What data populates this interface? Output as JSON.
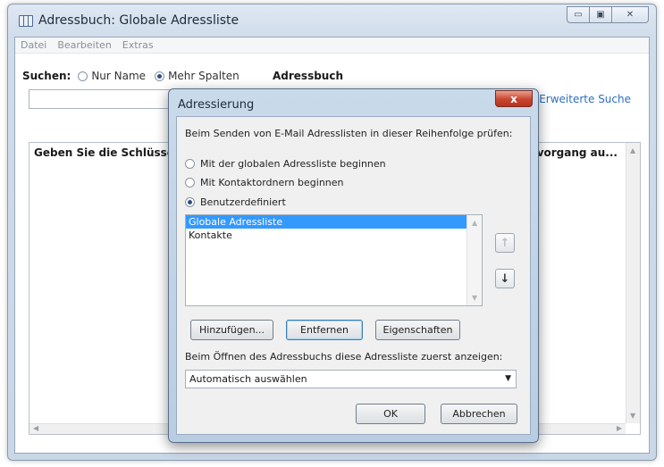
{
  "window": {
    "title": "Adressbuch: Globale Adressliste",
    "controls": {
      "minimize": "▭",
      "maximize": "▣",
      "close": "✕"
    }
  },
  "menu": [
    "Datei",
    "Bearbeiten",
    "Extras"
  ],
  "search": {
    "label": "Suchen:",
    "options": [
      "Nur Name",
      "Mehr Spalten"
    ],
    "selected": "Mehr Spalten",
    "addressbook_label": "Adressbuch",
    "advanced_link": "Erweiterte Suche"
  },
  "results": {
    "header_left": "Geben Sie die Schlüssel",
    "header_right": "vorgang au..."
  },
  "dialog": {
    "title": "Adressierung",
    "close": "x",
    "instruction": "Beim Senden von E-Mail Adresslisten in dieser Reihenfolge prüfen:",
    "options": [
      "Mit der globalen Adressliste beginnen",
      "Mit Kontaktordnern beginnen",
      "Benutzerdefiniert"
    ],
    "selected_option": "Benutzerdefiniert",
    "list_items": [
      "Globale Adressliste",
      "Kontakte"
    ],
    "selected_item": "Globale Adressliste",
    "move_up": "↑",
    "move_down": "↓",
    "buttons": {
      "add": "Hinzufügen...",
      "remove": "Entfernen",
      "properties": "Eigenschaften"
    },
    "open_label": "Beim Öffnen des Adressbuchs diese Adressliste zuerst anzeigen:",
    "open_value": "Automatisch auswählen",
    "ok": "OK",
    "cancel": "Abbrechen"
  },
  "colors": {
    "selection": "#3399ff",
    "link": "#2a6fc0",
    "close_button": "#c9452f"
  }
}
